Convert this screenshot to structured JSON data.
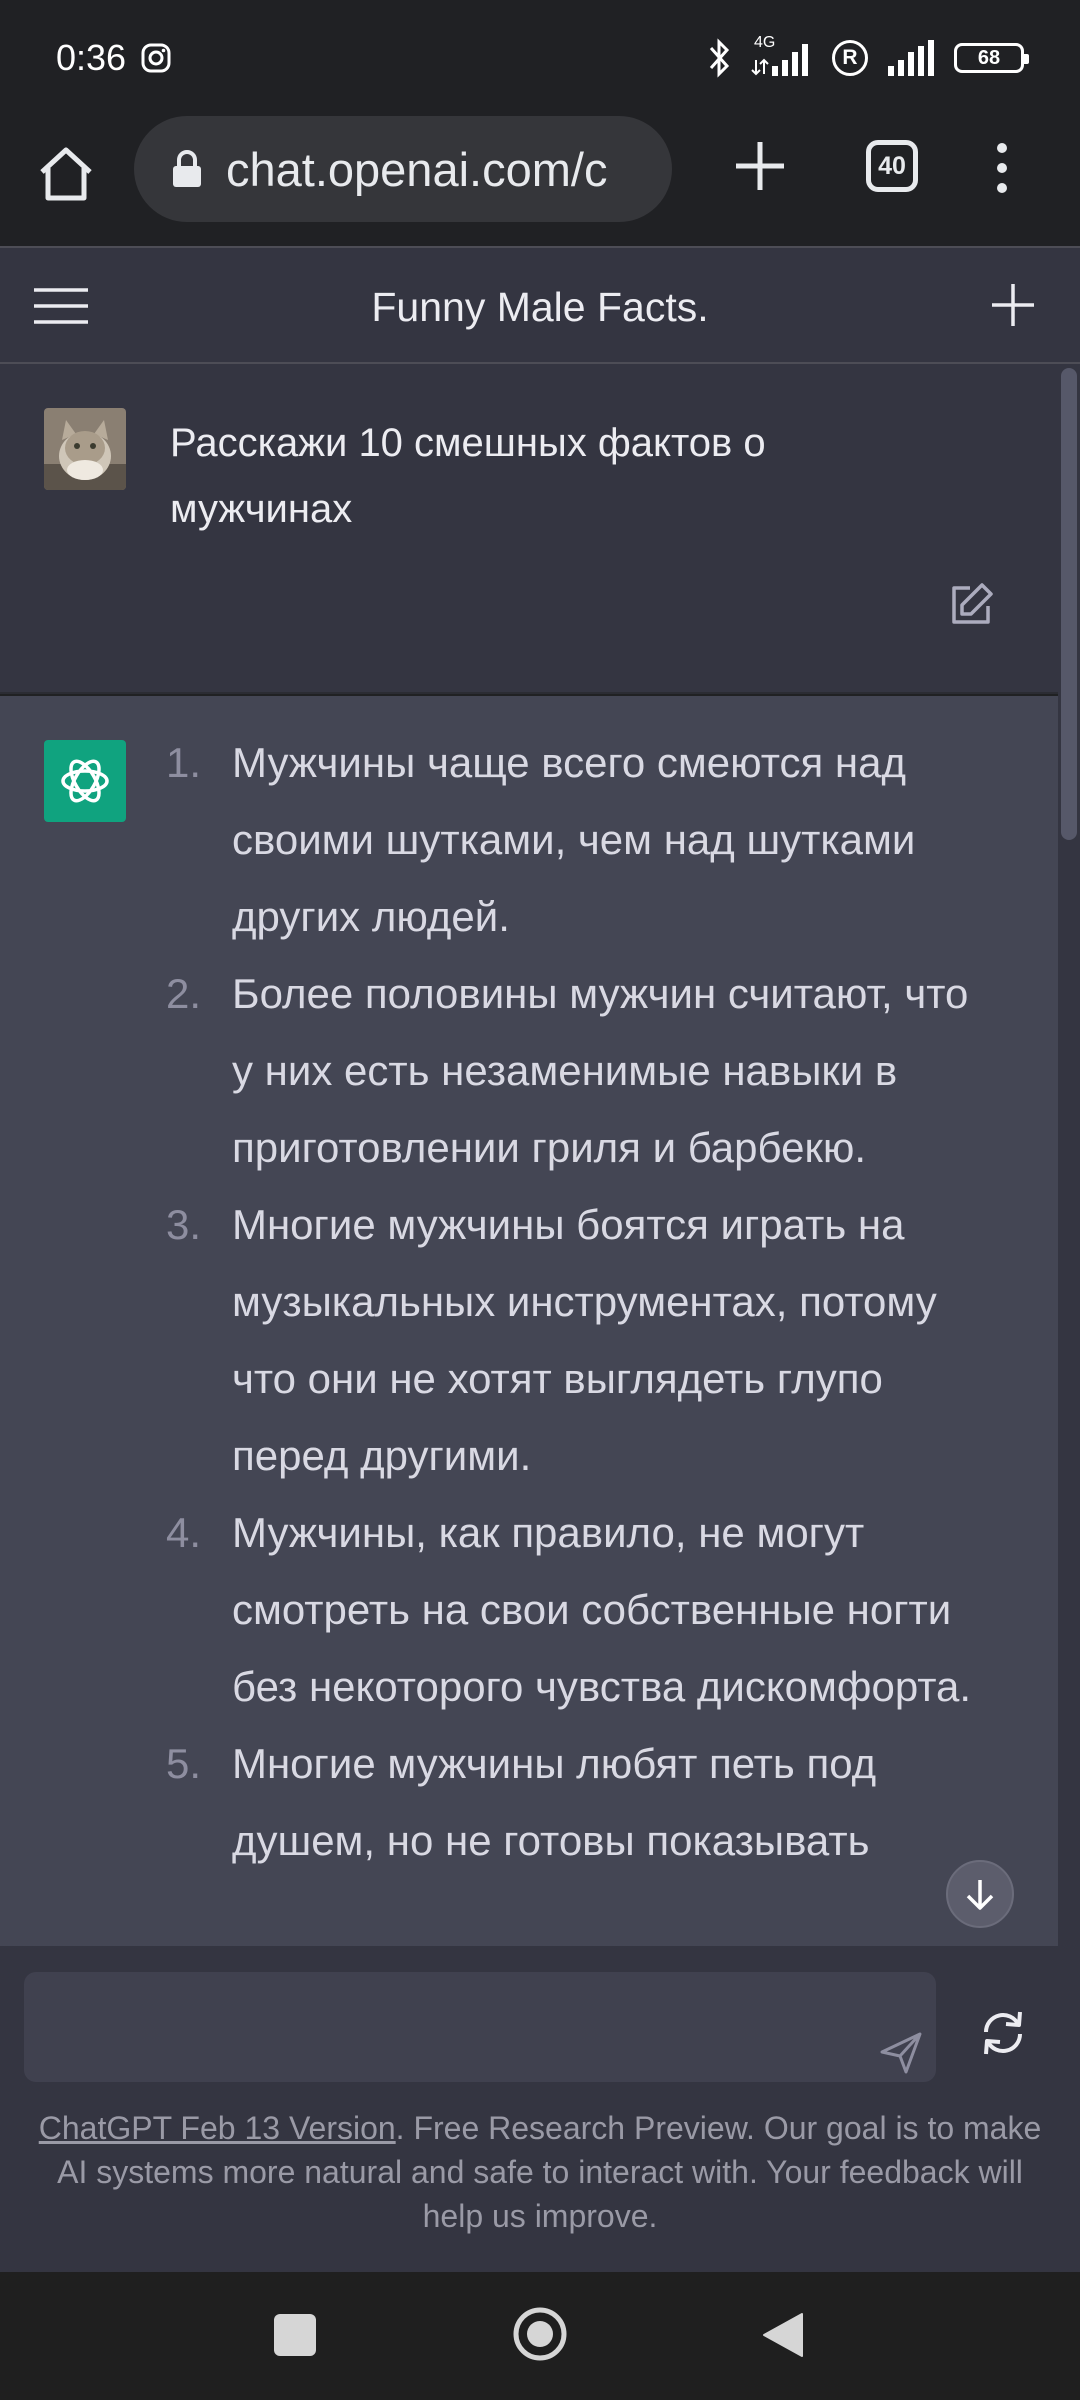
{
  "status_bar": {
    "time": "0:36",
    "network_label": "4G",
    "roaming": "R",
    "battery": "68"
  },
  "browser": {
    "url": "chat.openai.com/c",
    "tab_count": "40"
  },
  "chat": {
    "title": "Funny Male Facts."
  },
  "user_message": {
    "text": "Расскажи 10 смешных фактов о мужчинах"
  },
  "assistant_message": {
    "facts": [
      {
        "num": "1.",
        "text": "Мужчины чаще всего смеются над своими шутками, чем над шутками других людей."
      },
      {
        "num": "2.",
        "text": "Более половины мужчин считают, что у них есть незаменимые навыки в приготовлении гриля и барбекю."
      },
      {
        "num": "3.",
        "text": "Многие мужчины боятся играть на музыкальных инструментах, потому что они не хотят выглядеть глупо перед другими."
      },
      {
        "num": "4.",
        "text": "Мужчины, как правило, не могут смотреть на свои собственные ногти без некоторого чувства дискомфорта."
      },
      {
        "num": "5.",
        "text": "Многие мужчины любят петь под душем, но не готовы показывать"
      }
    ]
  },
  "composer": {
    "placeholder": "",
    "version_link": "ChatGPT Feb 13 Version",
    "disclaimer": ". Free Research Preview. Our goal is to make AI systems more natural and safe to interact with. Your feedback will help us improve."
  },
  "colors": {
    "page_bg": "#343541",
    "assistant_bg": "#444654",
    "accent": "#10a37f",
    "browser_bg": "#202124"
  }
}
